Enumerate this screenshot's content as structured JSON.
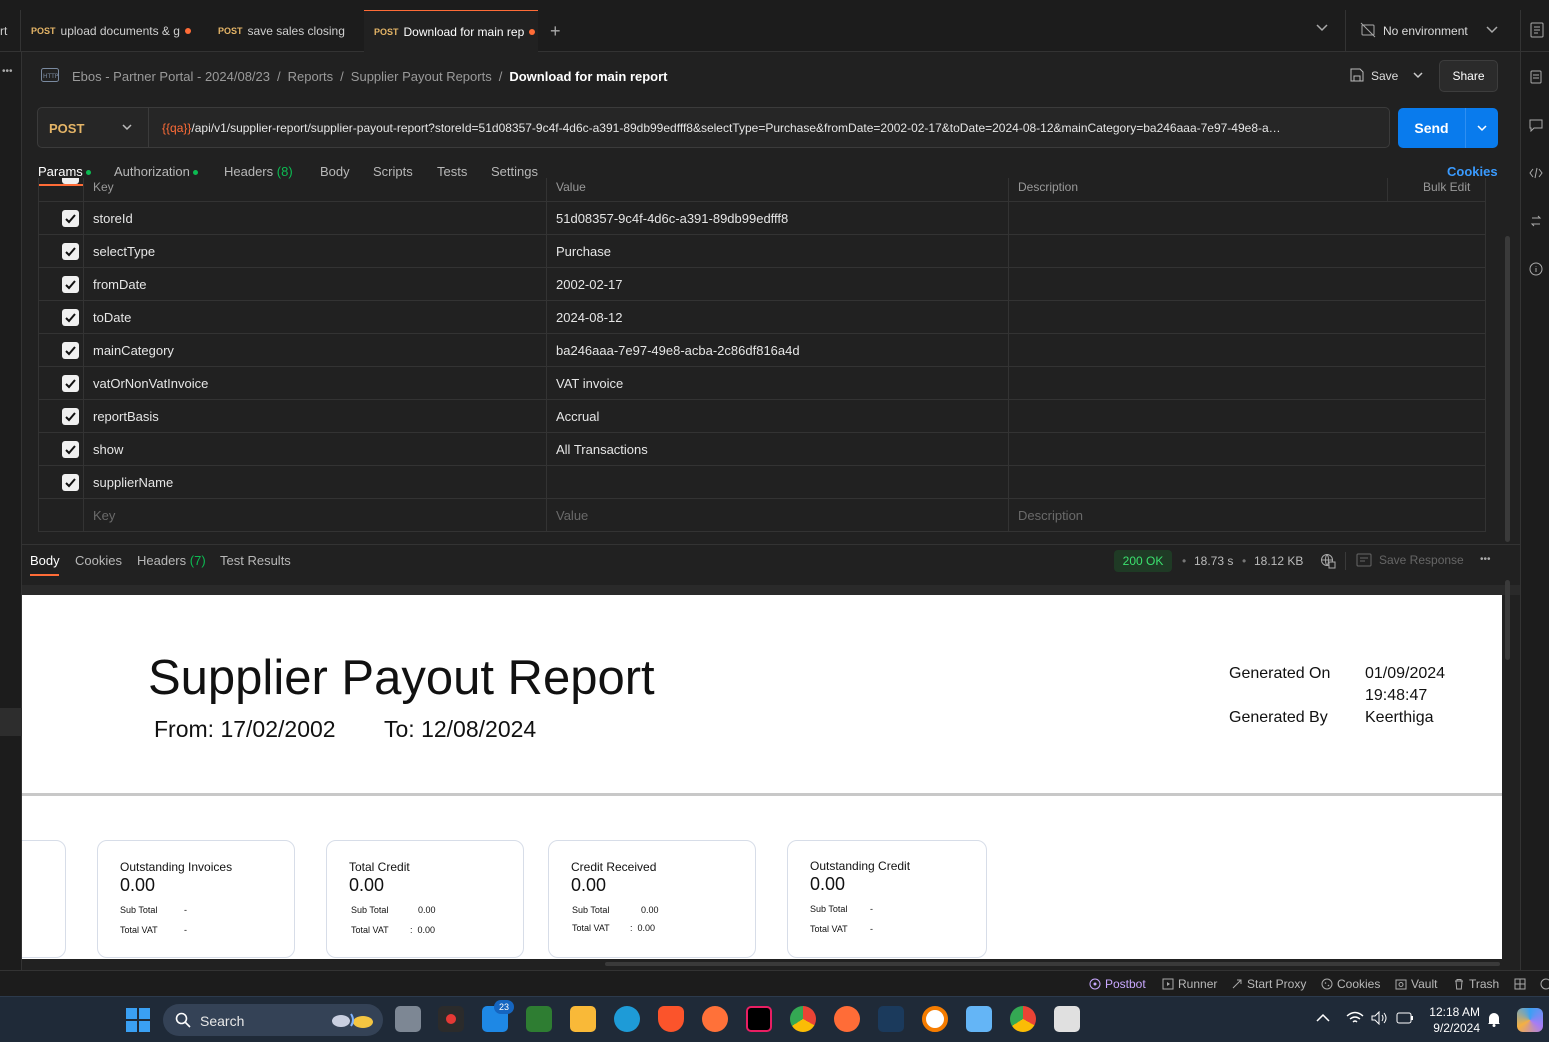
{
  "tabs": [
    {
      "method": "POST",
      "label": "upload documents & g",
      "unsaved": true
    },
    {
      "method": "POST",
      "label": "save sales closing",
      "unsaved": false
    },
    {
      "method": "POST",
      "label": "Download for main rep",
      "unsaved": true
    }
  ],
  "left_tab_fragment": "rt",
  "environment": "No environment",
  "breadcrumb": [
    "Ebos - Partner Portal - 2024/08/23",
    "Reports",
    "Supplier Payout Reports",
    "Download for main report"
  ],
  "breadcrumb_sep": "/",
  "actions": {
    "save": "Save",
    "share": "Share"
  },
  "request": {
    "method": "POST",
    "url_var": "{{qa}}",
    "url_rest": "/api/v1/supplier-report/supplier-payout-report?storeId=51d08357-9c4f-4d6c-a391-89db99edfff8&selectType=Purchase&fromDate=2002-02-17&toDate=2024-08-12&mainCategory=ba246aaa-7e97-49e8-a…",
    "send": "Send"
  },
  "request_tabs": {
    "params": "Params",
    "authorization": "Authorization",
    "headers": "Headers",
    "headers_count": "(8)",
    "body": "Body",
    "scripts": "Scripts",
    "tests": "Tests",
    "settings": "Settings",
    "cookies": "Cookies"
  },
  "params_header": {
    "key": "Key",
    "value": "Value",
    "description": "Description",
    "bulk": "Bulk Edit"
  },
  "params": [
    {
      "key": "storeId",
      "value": "51d08357-9c4f-4d6c-a391-89db99edfff8"
    },
    {
      "key": "selectType",
      "value": "Purchase"
    },
    {
      "key": "fromDate",
      "value": "2002-02-17"
    },
    {
      "key": "toDate",
      "value": "2024-08-12"
    },
    {
      "key": "mainCategory",
      "value": "ba246aaa-7e97-49e8-acba-2c86df816a4d"
    },
    {
      "key": "vatOrNonVatInvoice",
      "value": "VAT invoice"
    },
    {
      "key": "reportBasis",
      "value": "Accrual"
    },
    {
      "key": "show",
      "value": "All Transactions"
    },
    {
      "key": "supplierName",
      "value": ""
    }
  ],
  "params_placeholder": {
    "key": "Key",
    "value": "Value",
    "description": "Description"
  },
  "response_tabs": {
    "body": "Body",
    "cookies": "Cookies",
    "headers": "Headers",
    "headers_count": "(7)",
    "tests": "Test Results"
  },
  "response_meta": {
    "status": "200 OK",
    "time": "18.73 s",
    "size": "18.12 KB",
    "save_response": "Save Response"
  },
  "report": {
    "title": "Supplier Payout Report",
    "from_label": "From:",
    "from": "17/02/2002",
    "to_label": "To:",
    "to": "12/08/2024",
    "generated_on_label": "Generated On",
    "generated_on_date": "01/09/2024",
    "generated_on_time": "19:48:47",
    "generated_by_label": "Generated By",
    "generated_by": "Keerthiga",
    "cards": [
      {
        "label": "Outstanding Invoices",
        "value": "0.00",
        "sub_total_label": "Sub Total",
        "sub_total": "-",
        "vat_label": "Total VAT",
        "vat": "-"
      },
      {
        "label": "Total Credit",
        "value": "0.00",
        "sub_total_label": "Sub Total",
        "sub_total": "0.00",
        "vat_label": "Total VAT",
        "vat": ":  0.00"
      },
      {
        "label": "Credit Received",
        "value": "0.00",
        "sub_total_label": "Sub Total",
        "sub_total": "0.00",
        "vat_label": "Total VAT",
        "vat": ":  0.00"
      },
      {
        "label": "Outstanding Credit",
        "value": "0.00",
        "sub_total_label": "Sub Total",
        "sub_total": "-",
        "vat_label": "Total VAT",
        "vat": "-"
      }
    ]
  },
  "statusbar": {
    "postbot": "Postbot",
    "runner": "Runner",
    "proxy": "Start Proxy",
    "cookies": "Cookies",
    "vault": "Vault",
    "trash": "Trash"
  },
  "taskbar": {
    "search": "Search",
    "mail_badge": "23",
    "time": "12:18 AM",
    "date": "9/2/2024"
  },
  "colors": {
    "accent": "#ff6c37",
    "send": "#097bed",
    "ok": "#0cbb52",
    "method": "#e5b567"
  }
}
